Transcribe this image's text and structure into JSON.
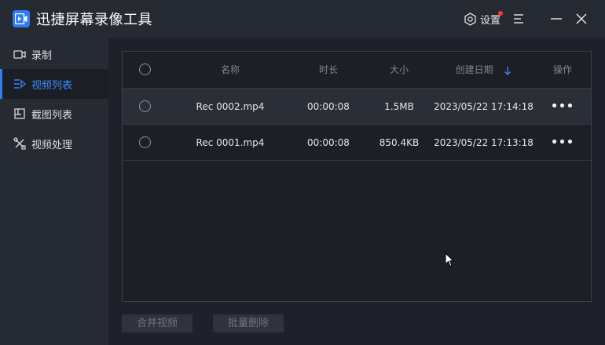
{
  "app": {
    "title": "迅捷屏幕录像工具",
    "settings_label": "设置",
    "accent_color": "#2f7cf6",
    "notice_color": "#ff3b30"
  },
  "sidebar": {
    "items": [
      {
        "label": "录制",
        "icon": "camera-icon",
        "active": false
      },
      {
        "label": "视频列表",
        "icon": "list-icon",
        "active": true
      },
      {
        "label": "截图列表",
        "icon": "screenshot-icon",
        "active": false
      },
      {
        "label": "视频处理",
        "icon": "tools-icon",
        "active": false
      }
    ]
  },
  "table": {
    "columns": {
      "name": "名称",
      "duration": "时长",
      "size": "大小",
      "date": "创建日期",
      "actions": "操作"
    },
    "rows": [
      {
        "name": "Rec 0002.mp4",
        "duration": "00:00:08",
        "size": "1.5MB",
        "date": "2023/05/22 17:14:18",
        "more": "•••"
      },
      {
        "name": "Rec 0001.mp4",
        "duration": "00:00:08",
        "size": "850.4KB",
        "date": "2023/05/22 17:13:18",
        "more": "•••"
      }
    ]
  },
  "footer": {
    "merge_label": "合并视频",
    "delete_label": "批量删除"
  }
}
